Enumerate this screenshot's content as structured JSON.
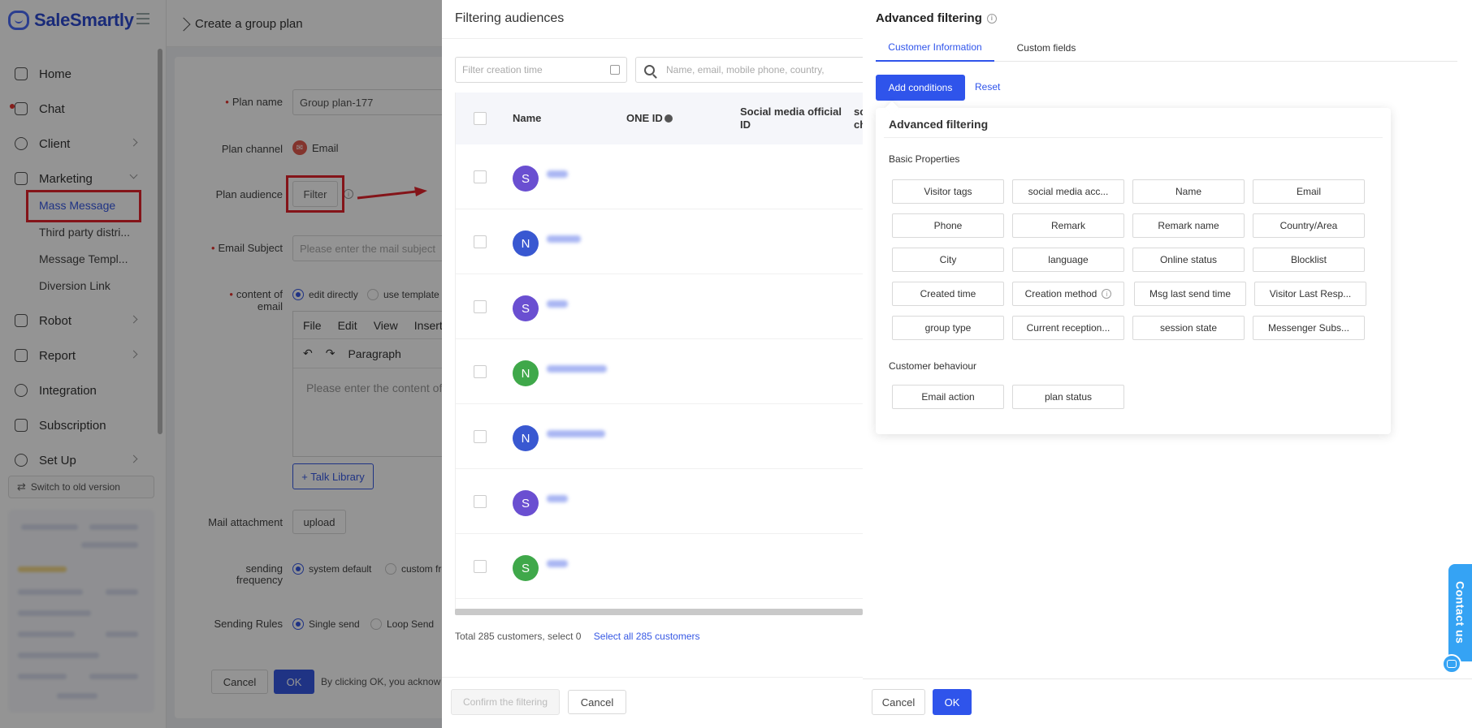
{
  "app": {
    "brand": "SaleSmartly",
    "page_title": "Create a group plan"
  },
  "sidebar": {
    "items": [
      {
        "label": "Home"
      },
      {
        "label": "Chat"
      },
      {
        "label": "Client"
      },
      {
        "label": "Marketing"
      },
      {
        "label": "Robot"
      },
      {
        "label": "Report"
      },
      {
        "label": "Integration"
      },
      {
        "label": "Subscription"
      },
      {
        "label": "Set Up"
      }
    ],
    "marketing_sub": [
      "Mass Message",
      "Third party distri...",
      "Message Templ...",
      "Diversion Link"
    ],
    "old_version": "Switch to old version"
  },
  "form": {
    "plan_name_label": "Plan name",
    "plan_name_value": "Group plan-177",
    "plan_channel_label": "Plan channel",
    "plan_channel_value": "Email",
    "plan_audience_label": "Plan audience",
    "filter_button": "Filter",
    "email_subject_label": "Email Subject",
    "email_subject_placeholder": "Please enter the mail subject",
    "content_label": "content of email",
    "edit_directly": "edit directly",
    "use_template": "use template",
    "editor_menu": [
      "File",
      "Edit",
      "View",
      "Insert"
    ],
    "editor_paragraph": "Paragraph",
    "editor_placeholder": "Please enter the content of",
    "talk_library": "+ Talk Library",
    "mail_attachment_label": "Mail attachment",
    "upload": "upload",
    "sending_frequency_label": "sending frequency",
    "system_default": "system default",
    "custom_freq": "custom fre",
    "sending_rules_label": "Sending Rules",
    "single_send": "Single send",
    "loop_send": "Loop Send",
    "cancel": "Cancel",
    "ok": "OK",
    "ack_text": "By clicking OK, you acknow"
  },
  "audience_drawer": {
    "title": "Filtering audiences",
    "date_placeholder": "Filter creation time",
    "search_placeholder": "Name, email, mobile phone, country,",
    "columns": [
      "Name",
      "ONE ID",
      "Social media official ID",
      "so ch"
    ],
    "rows": [
      {
        "initial": "S",
        "color": "s"
      },
      {
        "initial": "N",
        "color": "n"
      },
      {
        "initial": "S",
        "color": "s"
      },
      {
        "initial": "N",
        "color": "g"
      },
      {
        "initial": "N",
        "color": "n"
      },
      {
        "initial": "S",
        "color": "s"
      },
      {
        "initial": "S",
        "color": "g"
      }
    ],
    "total_text": "Total 285 customers, select 0",
    "select_all": "Select all 285 customers",
    "confirm": "Confirm the filtering",
    "cancel": "Cancel"
  },
  "advanced": {
    "title": "Advanced filtering",
    "tabs": [
      "Customer Information",
      "Custom fields"
    ],
    "add_conditions": "Add conditions",
    "reset": "Reset",
    "popover_title": "Advanced filtering",
    "basic_label": "Basic Properties",
    "basic_chips": [
      "Visitor tags",
      "social media acc...",
      "Name",
      "Email",
      "Phone",
      "Remark",
      "Remark name",
      "Country/Area",
      "City",
      "language",
      "Online status",
      "Blocklist",
      "Created time",
      "Creation method",
      "Msg last send time",
      "Visitor Last Resp...",
      "group type",
      "Current reception...",
      "session state",
      "Messenger Subs..."
    ],
    "behaviour_label": "Customer behaviour",
    "behaviour_chips": [
      "Email action",
      "plan status"
    ],
    "cancel": "Cancel",
    "ok": "OK",
    "contact_us": "Contact us"
  },
  "colors": {
    "primary": "#2f54eb",
    "highlight": "#e3242b",
    "contact": "#35a3f4"
  }
}
